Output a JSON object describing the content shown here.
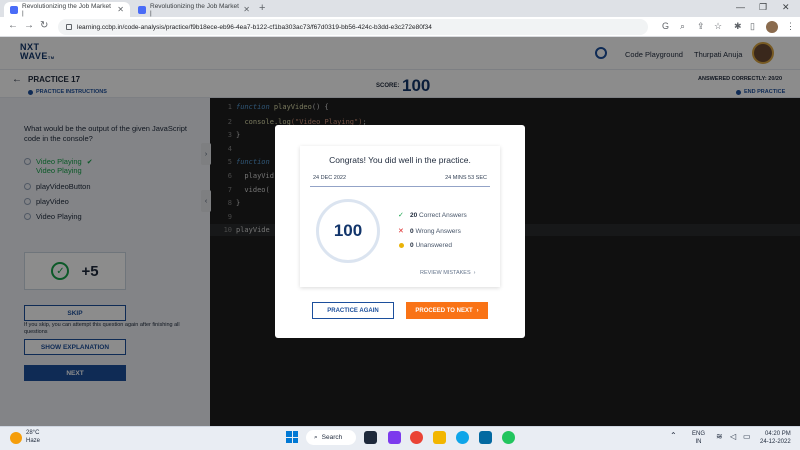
{
  "browser": {
    "tabs": [
      {
        "title": "Revolutionizing the Job Market |",
        "active": true
      },
      {
        "title": "Revolutionizing the Job Market |",
        "active": false
      }
    ],
    "url": "learning.ccbp.in/code-analysis/practice/f9b18ece-eb96-4ea7-b122-cf1ba303ac73/f67d0319-bb56-424c-b3dd-e3c272e80f34"
  },
  "header": {
    "logo_line1": "NXT",
    "logo_line2": "WAVE",
    "logo_suffix": "TM",
    "code_playground": "Code Playground",
    "user_name": "Thurpati Anuja"
  },
  "practice": {
    "title": "PRACTICE 17",
    "instructions": "PRACTICE INSTRUCTIONS",
    "score_label": "SCORE:",
    "score_value": "100",
    "answered": "ANSWERED CORRECTLY: 20/20",
    "end": "END PRACTICE"
  },
  "question": {
    "text": "What would be the output of the given JavaScript code in the console?",
    "options": [
      {
        "line1": "Video Playing",
        "line2": "Video Playing",
        "correct": true
      },
      {
        "line1": "playVideoButton",
        "line2": "",
        "correct": false
      },
      {
        "line1": "playVideo",
        "line2": "",
        "correct": false
      },
      {
        "line1": "Video Playing",
        "line2": "",
        "correct": false
      }
    ],
    "points": "+5",
    "skip_label": "SKIP",
    "skip_note": "If you skip, you can attempt this question again after finishing all questions",
    "show_explanation": "SHOW EXPLANATION",
    "next_label": "NEXT"
  },
  "code": {
    "lines": [
      {
        "n": "1",
        "kw": "function",
        "fn": " playVideo",
        "rest": "() {"
      },
      {
        "n": "2",
        "pre": "  ",
        "fn": "console.log",
        "str": "(\"Video Playing\")",
        "rest": ";"
      },
      {
        "n": "3",
        "rest": "}"
      },
      {
        "n": "4",
        "rest": ""
      },
      {
        "n": "5",
        "kw": "function",
        "rest": ""
      },
      {
        "n": "6",
        "rest": "  playVid"
      },
      {
        "n": "7",
        "rest": "  video("
      },
      {
        "n": "8",
        "rest": "}"
      },
      {
        "n": "9",
        "rest": ""
      },
      {
        "n": "10",
        "rest": "playVide"
      }
    ]
  },
  "modal": {
    "congrats": "Congrats! You did well in the practice.",
    "date": "24 DEC 2022",
    "duration": "24 MINS 53 SEC",
    "score": "100",
    "correct_count": "20",
    "correct_label": "Correct Answers",
    "wrong_count": "0",
    "wrong_label": "Wrong Answers",
    "unanswered_count": "0",
    "unanswered_label": "Unanswered",
    "review": "REVIEW MISTAKES",
    "practice_again": "PRACTICE AGAIN",
    "proceed": "PROCEED TO NEXT"
  },
  "taskbar": {
    "temp": "28°C",
    "weather": "Haze",
    "search": "Search",
    "lang1": "ENG",
    "lang2": "IN",
    "time": "04:20 PM",
    "date": "24-12-2022"
  },
  "colors": {
    "brand_blue": "#1c4f9c",
    "orange": "#f97316",
    "correct_green": "#16a34a",
    "wrong_red": "#dc2626"
  }
}
